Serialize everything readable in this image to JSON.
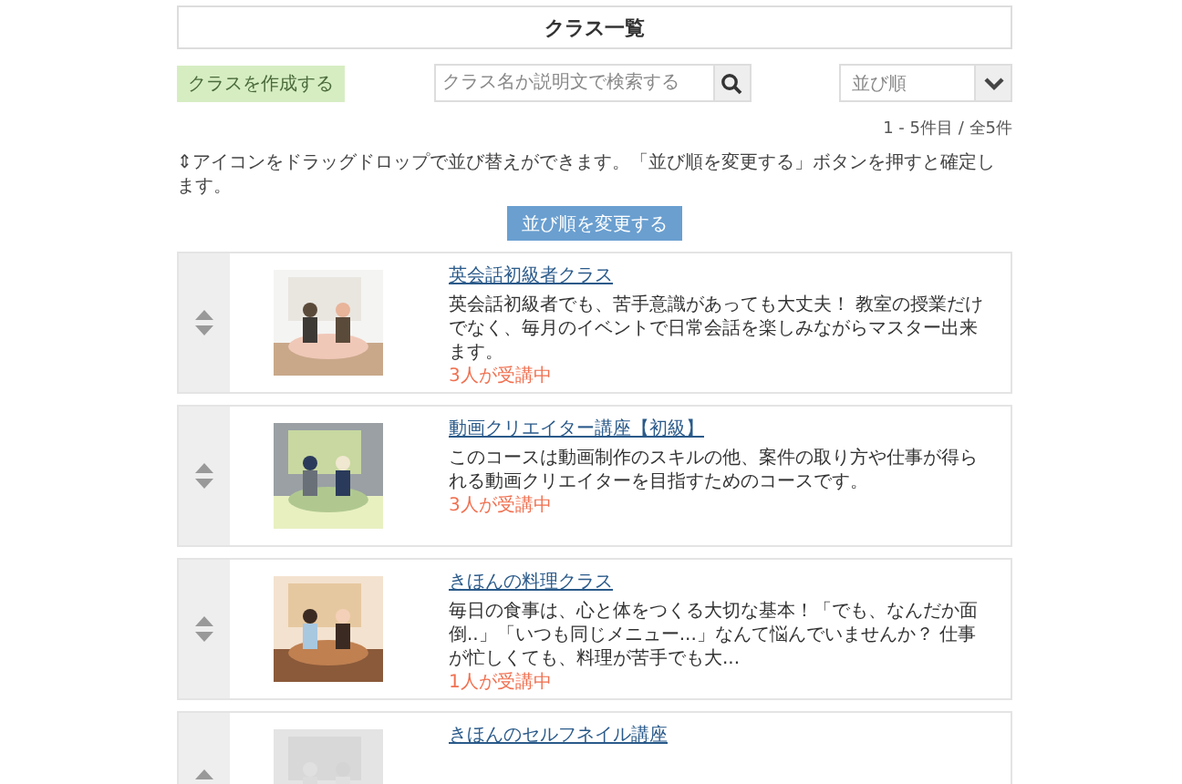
{
  "header": {
    "title": "クラス一覧"
  },
  "toolbar": {
    "create_button": "クラスを作成する",
    "search": {
      "placeholder": "クラス名か説明文で検索する"
    },
    "sort_select": {
      "placeholder": "並び順"
    }
  },
  "result_count": "1 - 5件目 / 全5件",
  "note": "⇕アイコンをドラッグドロップで並び替えができます。「並び順を変更する」ボタンを押すと確定します。",
  "reorder_button": "並び順を変更する",
  "classes": [
    {
      "title": "英会話初級者クラス",
      "description": "英会話初級者でも、苦手意識があっても大丈夫！ 教室の授業だけでなく、毎月のイベントで日常会話を楽しみながらマスター出来ます。",
      "enrollment": "3人が受講中"
    },
    {
      "title": "動画クリエイター講座【初級】",
      "description": "このコースは動画制作のスキルの他、案件の取り方や仕事が得られる動画クリエイターを目指すためのコースです。",
      "enrollment": "3人が受講中"
    },
    {
      "title": "きほんの料理クラス",
      "description": "毎日の食事は、心と体をつくる大切な基本！「でも、なんだか面倒..」「いつも同じメニュー...」なんて悩んでいませんか？ 仕事が忙しくても、料理が苦手でも大...",
      "enrollment": "1人が受講中"
    },
    {
      "title": "きほんのセルフネイル講座"
    }
  ]
}
